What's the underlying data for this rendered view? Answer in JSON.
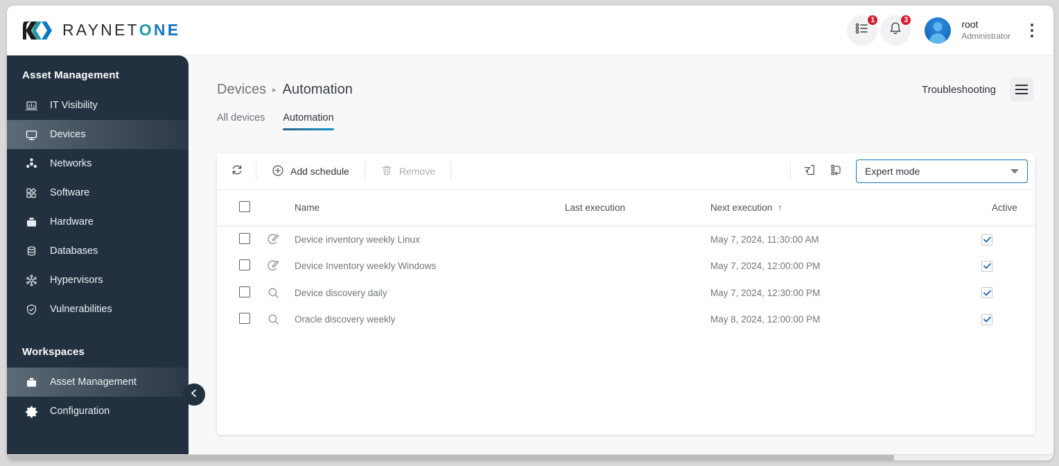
{
  "brand": {
    "name_plain": "RAYNET",
    "name_o": "O",
    "name_n": "N",
    "name_e": "E",
    "logo_icon": "raynet-bracket-logo"
  },
  "topbar": {
    "tasks_badge": "1",
    "notifications_badge": "3",
    "tasks_icon": "task-list-icon",
    "bell_icon": "bell-icon",
    "kebab_icon": "more-vertical-icon",
    "user": {
      "name": "root",
      "role": "Administrator"
    }
  },
  "sidebar": {
    "section_title": "Asset Management",
    "workspaces_title": "Workspaces",
    "items": [
      {
        "label": "IT Visibility",
        "icon": "laptop-chart-icon",
        "active": false
      },
      {
        "label": "Devices",
        "icon": "monitor-icon",
        "active": true
      },
      {
        "label": "Networks",
        "icon": "network-nodes-icon",
        "active": false
      },
      {
        "label": "Software",
        "icon": "squares-diamond-icon",
        "active": false
      },
      {
        "label": "Hardware",
        "icon": "toolbox-icon",
        "active": false
      },
      {
        "label": "Databases",
        "icon": "database-icon",
        "active": false
      },
      {
        "label": "Hypervisors",
        "icon": "hypervisor-star-icon",
        "active": false
      },
      {
        "label": "Vulnerabilities",
        "icon": "shield-check-icon",
        "active": false
      }
    ],
    "workspaces": [
      {
        "label": "Asset Management",
        "icon": "briefcase-icon",
        "active": true
      },
      {
        "label": "Configuration",
        "icon": "gear-icon",
        "active": false
      }
    ],
    "collapse_icon": "chevron-left-icon"
  },
  "header": {
    "breadcrumb_parent": "Devices",
    "breadcrumb_separator": "▸",
    "breadcrumb_current": "Automation",
    "troubleshooting": "Troubleshooting",
    "menu_icon": "hamburger-menu-icon"
  },
  "tabs": [
    {
      "label": "All devices",
      "active": false
    },
    {
      "label": "Automation",
      "active": true
    }
  ],
  "toolbar": {
    "refresh_icon": "refresh-icon",
    "add_label": "Add schedule",
    "add_icon": "plus-circle-icon",
    "remove_label": "Remove",
    "remove_icon": "trash-icon",
    "export_icon": "export-filter-icon",
    "columns_icon": "columns-layout-icon",
    "mode_value": "Expert mode",
    "mode_arrow_icon": "chevron-down-icon"
  },
  "table": {
    "columns": [
      "Name",
      "Last execution",
      "Next execution",
      "Active"
    ],
    "sort_column": "Next execution",
    "sort_arrow": "↑",
    "select_all_checked": false,
    "rows": [
      {
        "icon": "inventory-scan-icon",
        "name": "Device inventory weekly Linux",
        "last_execution": "",
        "next_execution": "May 7, 2024, 11:30:00 AM",
        "active": true
      },
      {
        "icon": "inventory-scan-icon",
        "name": "Device Inventory weekly Windows",
        "last_execution": "",
        "next_execution": "May 7, 2024, 12:00:00 PM",
        "active": true
      },
      {
        "icon": "magnifier-icon",
        "name": "Device discovery daily",
        "last_execution": "",
        "next_execution": "May 7, 2024, 12:30:00 PM",
        "active": true
      },
      {
        "icon": "magnifier-icon",
        "name": "Oracle discovery weekly",
        "last_execution": "",
        "next_execution": "May 8, 2024, 12:00:00 PM",
        "active": true
      }
    ]
  },
  "colors": {
    "sidebar_bg": "#22303f",
    "accent_blue": "#108fd0",
    "badge_red": "#d91b2b",
    "select_border": "#1a73b8"
  }
}
